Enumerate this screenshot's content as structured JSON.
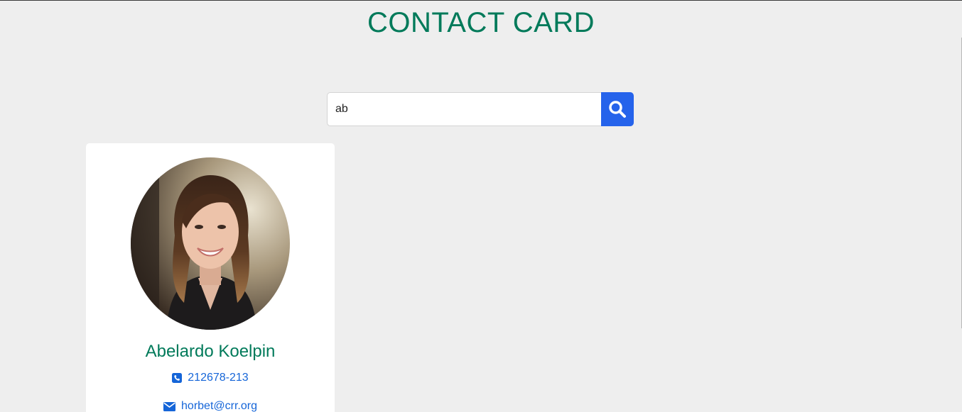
{
  "header": {
    "title": "CONTACT CARD"
  },
  "search": {
    "value": "ab",
    "icon": "search-icon"
  },
  "contacts": [
    {
      "name": "Abelardo Koelpin",
      "phone": "212678-213",
      "email": "horbet@crr.org",
      "avatar_icon": "avatar-photo"
    }
  ],
  "colors": {
    "title": "#017a5a",
    "link": "#1565d8",
    "search_button": "#2563eb",
    "background": "#eeeeee"
  }
}
